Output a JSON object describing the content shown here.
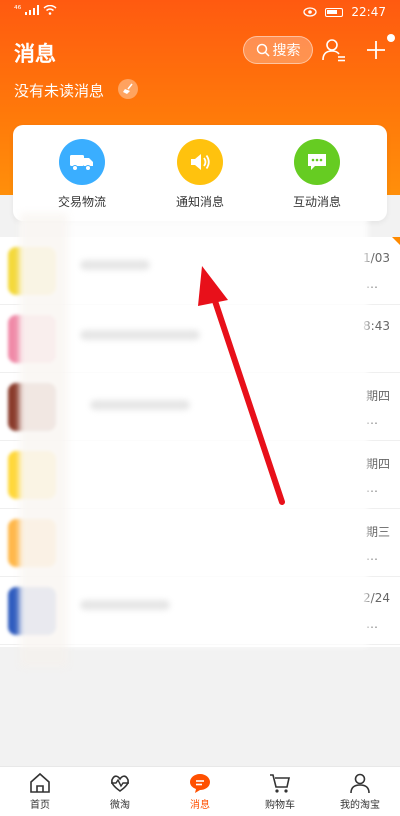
{
  "status_bar": {
    "signal": "⁴⁶",
    "time": "22:47"
  },
  "header": {
    "title": "消息",
    "search_label": "搜索",
    "subtitle": "没有未读消息"
  },
  "quick_actions": [
    {
      "label": "交易物流",
      "color": "#3aaeff",
      "icon": "truck-icon"
    },
    {
      "label": "通知消息",
      "color": "#ffc20e",
      "icon": "speaker-icon"
    },
    {
      "label": "互动消息",
      "color": "#66cc22",
      "icon": "chat-bubble-icon"
    }
  ],
  "messages": [
    {
      "time": "1/03",
      "ellipsis": "…",
      "color": "#f4d93b"
    },
    {
      "time": "8:43",
      "ellipsis": "",
      "color": "#f08aa8"
    },
    {
      "time": "期四",
      "ellipsis": "…",
      "color": "#8a3b2b"
    },
    {
      "time": "期四",
      "ellipsis": "…",
      "color": "#ffd83a"
    },
    {
      "time": "期三",
      "ellipsis": "…",
      "color": "#ffb84a"
    },
    {
      "time": "2/24",
      "ellipsis": "…",
      "color": "#2f5cbf"
    }
  ],
  "tabbar": [
    {
      "label": "首页",
      "icon": "home-icon",
      "active": false
    },
    {
      "label": "微淘",
      "icon": "heart-wave-icon",
      "active": false
    },
    {
      "label": "消息",
      "icon": "message-icon",
      "active": true
    },
    {
      "label": "购物车",
      "icon": "cart-icon",
      "active": false
    },
    {
      "label": "我的淘宝",
      "icon": "profile-icon",
      "active": false
    }
  ],
  "colors": {
    "brand": "#ff5a10",
    "active_tab": "#ff5000",
    "annotation_arrow": "#e8101a"
  }
}
